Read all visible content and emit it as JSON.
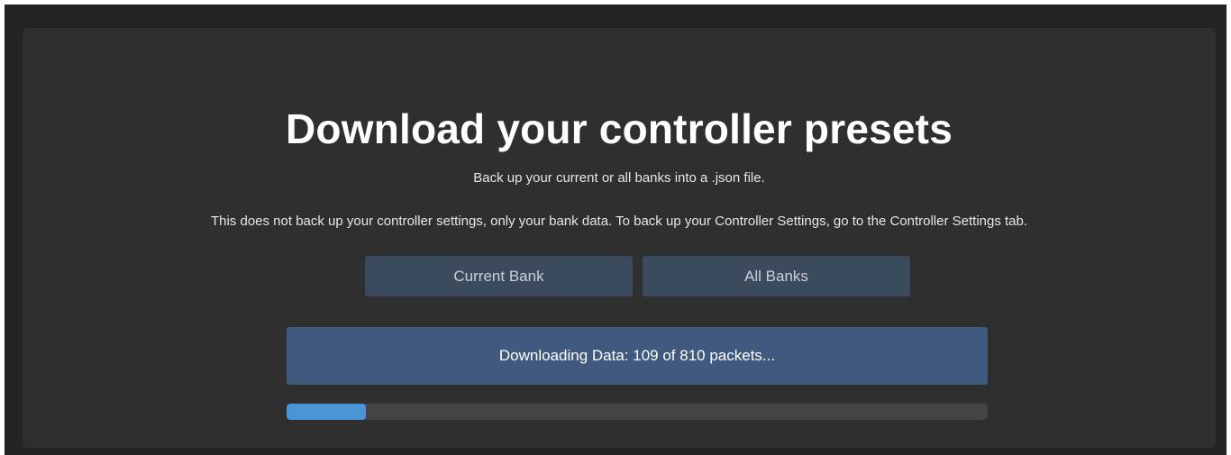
{
  "header": {
    "title": "Download your controller presets",
    "subtitle": "Back up your current or all banks into a .json file.",
    "note": "This does not back up your controller settings, only your bank data. To back up your Controller Settings, go to the Controller Settings tab."
  },
  "buttons": {
    "current_bank": "Current Bank",
    "all_banks": "All Banks"
  },
  "download": {
    "status_text": "Downloading Data: 109 of 810 packets...",
    "packets_done": 109,
    "packets_total": 810,
    "progress_fraction": 0.113
  },
  "colors": {
    "background": "#232323",
    "panel": "#2f2f2f",
    "button": "#3c4a5e",
    "status_box": "#3f5a7e",
    "progress_fill": "#4a94d8",
    "progress_track": "#444444"
  }
}
